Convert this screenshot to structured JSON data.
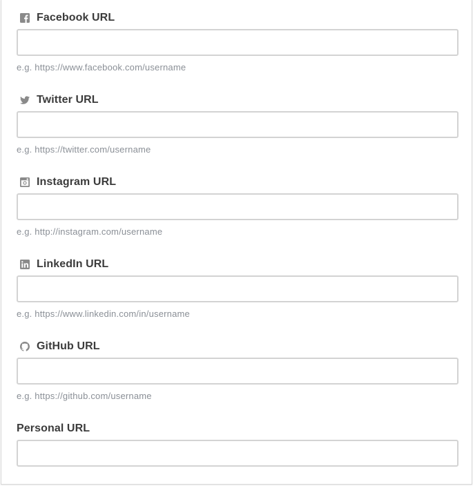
{
  "fields": [
    {
      "label": "Facebook URL",
      "icon": "facebook-icon",
      "value": "",
      "hint": "e.g. https://www.facebook.com/username"
    },
    {
      "label": "Twitter URL",
      "icon": "twitter-icon",
      "value": "",
      "hint": "e.g. https://twitter.com/username"
    },
    {
      "label": "Instagram URL",
      "icon": "instagram-icon",
      "value": "",
      "hint": "e.g. http://instagram.com/username"
    },
    {
      "label": "LinkedIn URL",
      "icon": "linkedin-icon",
      "value": "",
      "hint": "e.g. https://www.linkedin.com/in/username"
    },
    {
      "label": "GitHub URL",
      "icon": "github-icon",
      "value": "",
      "hint": "e.g. https://github.com/username"
    },
    {
      "label": "Personal URL",
      "icon": "",
      "value": ""
    }
  ],
  "colors": {
    "icon": "#8a8a8a",
    "label": "#3b3b3b",
    "hint": "#8a8f96",
    "input_border": "#d3d3d3"
  }
}
